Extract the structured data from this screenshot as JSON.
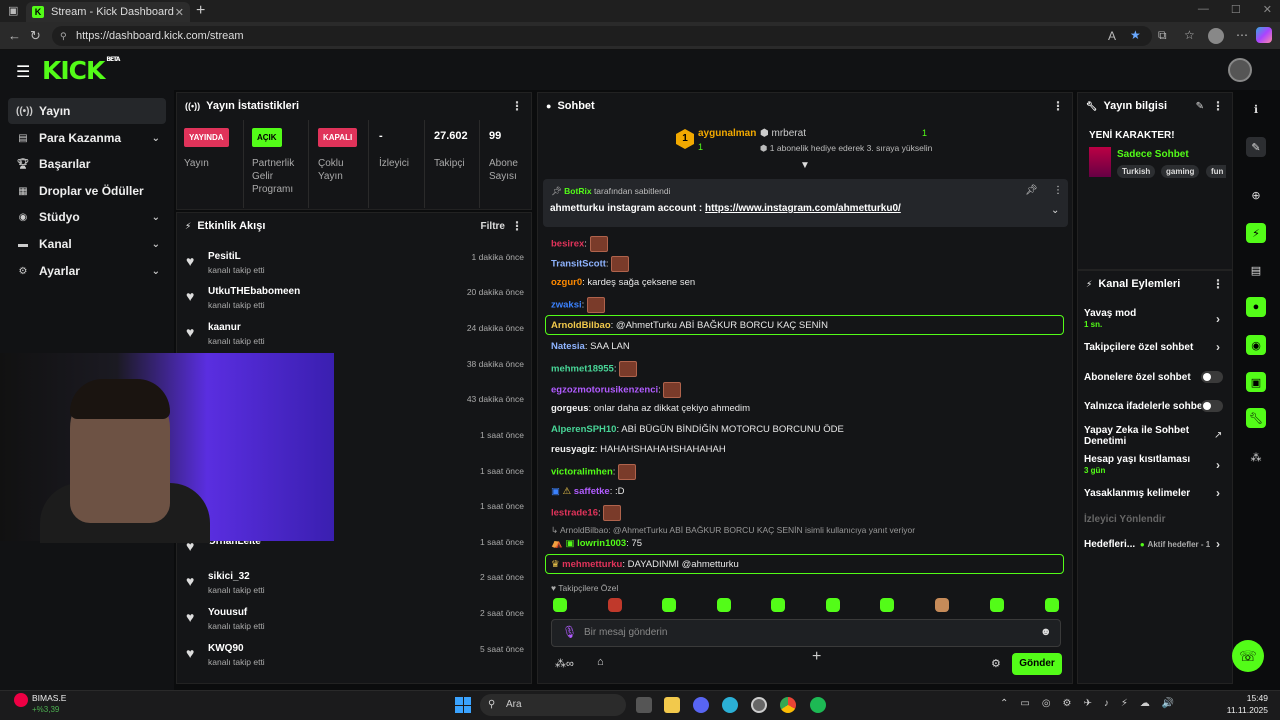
{
  "browser": {
    "tab_title": "Stream - Kick Dashboard",
    "url": "https://dashboard.kick.com/stream"
  },
  "header": {
    "logo": "KICK",
    "logo_badge": "BETA"
  },
  "sidebar": {
    "items": [
      {
        "label": "Yayın",
        "icon": "broadcast-icon"
      },
      {
        "label": "Para Kazanma",
        "icon": "money-icon"
      },
      {
        "label": "Başarılar",
        "icon": "trophy-icon"
      },
      {
        "label": "Droplar ve Ödüller",
        "icon": "gift-icon"
      },
      {
        "label": "Stüdyo",
        "icon": "studio-icon"
      },
      {
        "label": "Kanal",
        "icon": "channel-icon"
      },
      {
        "label": "Ayarlar",
        "icon": "gear-icon"
      }
    ]
  },
  "stats": {
    "title": "Yayın İstatistikleri",
    "items": [
      {
        "badge": "YAYINDA",
        "label": "Yayın"
      },
      {
        "badge": "AÇIK",
        "label": "Partnerlik Gelir Programı"
      },
      {
        "badge": "KAPALI",
        "label": "Çoklu Yayın"
      },
      {
        "value": "-",
        "label": "İzleyici"
      },
      {
        "value": "27.602",
        "label": "Takipçi"
      },
      {
        "value": "99",
        "label": "Abone Sayısı"
      }
    ]
  },
  "activity": {
    "title": "Etkinlik Akışı",
    "filter": "Filtre",
    "items": [
      {
        "name": "PesitiL",
        "sub": "kanalı takip etti",
        "time": "1 dakika önce"
      },
      {
        "name": "UtkuTHEbabomeen",
        "sub": "kanalı takip etti",
        "time": "20 dakika önce"
      },
      {
        "name": "kaanur",
        "sub": "kanalı takip etti",
        "time": "24 dakika önce"
      },
      {
        "name": "",
        "sub": "",
        "time": "38 dakika önce"
      },
      {
        "name": "",
        "sub": "",
        "time": "43 dakika önce"
      },
      {
        "name": "",
        "sub": "",
        "time": "1 saat önce"
      },
      {
        "name": "",
        "sub": "",
        "time": "1 saat önce"
      },
      {
        "name": "",
        "sub": "",
        "time": "1 saat önce"
      },
      {
        "name": "OrhanLelte",
        "sub": "",
        "time": "1 saat önce"
      },
      {
        "name": "sikici_32",
        "sub": "kanalı takip etti",
        "time": "2 saat önce"
      },
      {
        "name": "Youusuf",
        "sub": "kanalı takip etti",
        "time": "2 saat önce"
      },
      {
        "name": "KWQ90",
        "sub": "kanalı takip etti",
        "time": "5 saat önce"
      }
    ]
  },
  "chat": {
    "title": "Sohbet",
    "gifter1": {
      "rank": "1",
      "name": "aygunalman",
      "count": "1"
    },
    "gifter2": {
      "name": "mrberat",
      "count": "1",
      "note": "1 abonelik hediye ederek 3. sıraya yükselin"
    },
    "pinned": {
      "by": "BotRix",
      "by_suffix": "tarafından sabitlendi",
      "text": "ahmetturku instagram account : ",
      "link": "https://www.instagram.com/ahmetturku0/"
    },
    "messages": [
      {
        "user": "besirex",
        "text": "",
        "emote": true,
        "color": "#e0335a"
      },
      {
        "user": "TransitScott",
        "text": "",
        "emote": true,
        "color": "#8fb4ff"
      },
      {
        "user": "ozgur0",
        "text": "kardeş sağa çeksene sen",
        "color": "#ff8a00"
      },
      {
        "user": "zwaksi",
        "text": "",
        "emote": true,
        "color": "#3b82ff"
      },
      {
        "user": "ArnoldBilbao",
        "text": "@AhmetTurku ABİ BAĞKUR BORCU KAÇ SENİN",
        "color": "#f2c94c",
        "highlight": true
      },
      {
        "user": "Natesia",
        "text": "SAA LAN",
        "color": "#8fb4ff"
      },
      {
        "user": "mehmet18955",
        "text": "",
        "emote": true,
        "color": "#53fc18"
      },
      {
        "user": "egzozmotorusikenzenci",
        "text": "",
        "emote": true,
        "color": "#b15cff"
      },
      {
        "user": "gorgeus",
        "text": "onlar daha az dikkat çekiyo ahmedim",
        "color": "#f2f2f2"
      },
      {
        "user": "AlperenSPH10",
        "text": "ABİ BÜGÜN BİNDİĞİN MOTORCU BORCUNU ÖDE",
        "color": "#48d597"
      },
      {
        "user": "reusyagiz",
        "text": "HAHAHSHAHAHSHAHAHAH",
        "color": "#f2f2f2"
      },
      {
        "user": "victoralimhen",
        "text": "",
        "emote": true,
        "color": "#53fc18"
      },
      {
        "user": "saffetke",
        "text": ":D",
        "color": "#b15cff"
      },
      {
        "user": "lestrade16",
        "text": "",
        "emote": true,
        "color": "#e0335a"
      },
      {
        "user": "lowrin1003",
        "text": "75",
        "color": "#53fc18",
        "reply": "ArnoldBilbao: @AhmetTurku ABİ BAĞKUR BORCU KAÇ SENİN isimli kullanıcıya yanıt veriyor"
      },
      {
        "user": "mehmetturku",
        "text": "DAYADINMI @ahmetturku",
        "color": "#e0335a",
        "highlight": true
      }
    ],
    "followers_only": "Takipçilere Özel",
    "input_placeholder": "Bir mesaj gönderin",
    "send": "Gönder"
  },
  "stream_info": {
    "title": "Yayın bilgisi",
    "stream_title": "YENİ KARAKTER!",
    "category": "Sadece Sohbet",
    "tags": [
      "Turkish",
      "gaming",
      "fun"
    ]
  },
  "channel_actions": {
    "title": "Kanal Eylemleri",
    "slow_mode": "Yavaş mod",
    "slow_mode_value": "1 sn.",
    "followers_chat": "Takipçilere özel sohbet",
    "subs_chat": "Abonelere özel sohbet",
    "emotes_chat": "Yalnızca ifadelerle sohbet",
    "ai_moderation": "Yapay Zeka ile Sohbet Denetimi",
    "account_age": "Hesap yaşı kısıtlaması",
    "account_age_value": "3 gün",
    "banned_words": "Yasaklanmış kelimeler",
    "viewer_redirect": "İzleyici Yönlendir",
    "goals": "Hedefleri...",
    "goals_status": "Aktif hedefler - 1"
  },
  "taskbar": {
    "stock_name": "BIMAS.E",
    "stock_change": "+%3,39",
    "search": "Ara",
    "time": "15:49",
    "date": "11.11.2025"
  }
}
